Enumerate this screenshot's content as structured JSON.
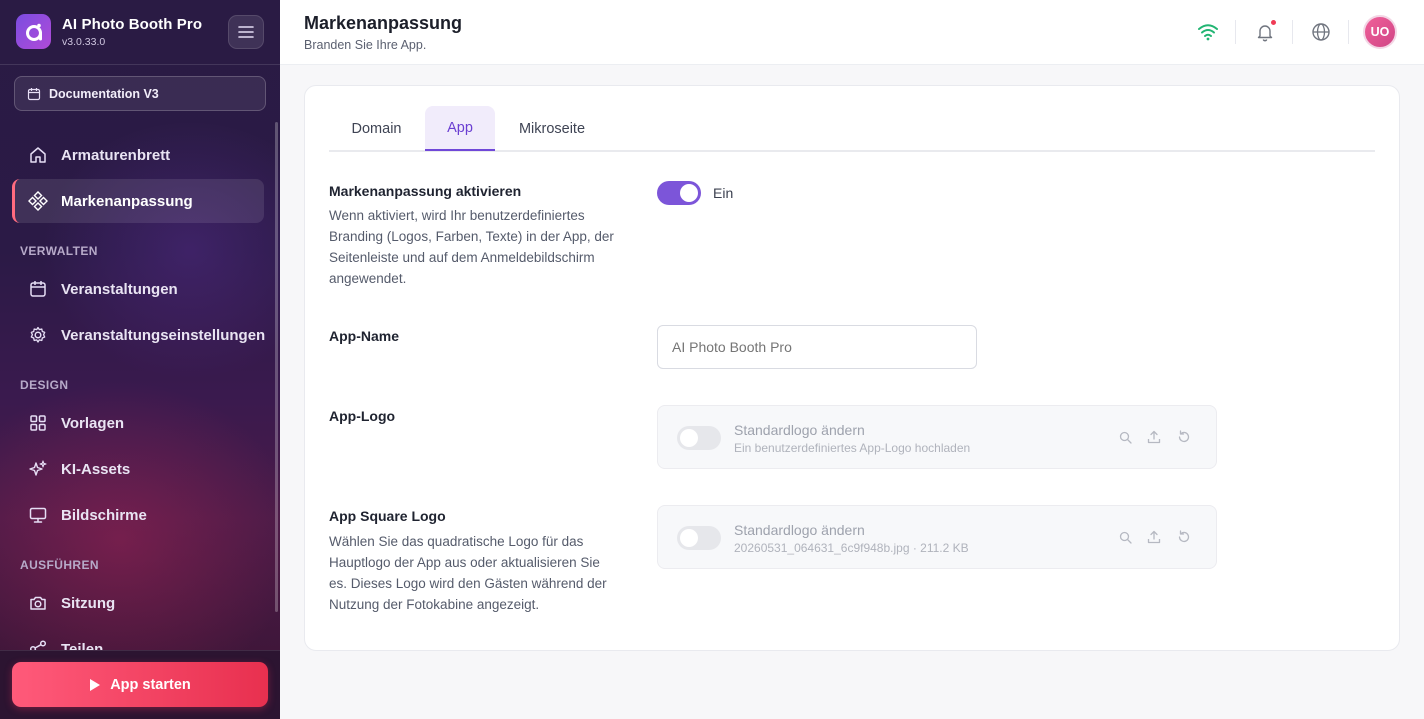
{
  "app": {
    "title": "AI Photo Booth Pro",
    "version": "v3.0.33.0"
  },
  "sidebar": {
    "doc_button": "Documentation V3",
    "items_top": [
      {
        "label": "Armaturenbrett",
        "icon": "home-icon"
      },
      {
        "label": "Markenanpassung",
        "icon": "diamond-grid-icon",
        "active": true
      }
    ],
    "section_manage": "VERWALTEN",
    "items_manage": [
      {
        "label": "Veranstaltungen",
        "icon": "calendar-icon"
      },
      {
        "label": "Veranstaltungseinstellungen",
        "icon": "gear-icon"
      }
    ],
    "section_design": "DESIGN",
    "items_design": [
      {
        "label": "Vorlagen",
        "icon": "grid-icon"
      },
      {
        "label": "KI-Assets",
        "icon": "sparkles-icon"
      },
      {
        "label": "Bildschirme",
        "icon": "monitor-icon"
      }
    ],
    "section_run": "AUSFÜHREN",
    "items_run": [
      {
        "label": "Sitzung",
        "icon": "camera-icon"
      },
      {
        "label": "Teilen",
        "icon": "share-icon"
      }
    ],
    "start_button": "App starten"
  },
  "header": {
    "title": "Markenanpassung",
    "subtitle": "Branden Sie Ihre App.",
    "avatar_initials": "UO",
    "colors": {
      "wifi": "#22b573",
      "notification_dot": "#ef3b55",
      "accent": "#7c55d9"
    }
  },
  "tabs": [
    {
      "label": "Domain",
      "active": false
    },
    {
      "label": "App",
      "active": true
    },
    {
      "label": "Mikroseite",
      "active": false
    }
  ],
  "form": {
    "branding": {
      "label": "Markenanpassung aktivieren",
      "description": "Wenn aktiviert, wird Ihr benutzerdefiniertes Branding (Logos, Farben, Texte) in der App, der Seitenleiste und auf dem Anmeldebildschirm angewendet.",
      "toggle_state": "Ein",
      "enabled": true
    },
    "app_name": {
      "label": "App-Name",
      "placeholder": "AI Photo Booth Pro"
    },
    "app_logo": {
      "label": "App-Logo",
      "title": "Standardlogo ändern",
      "subtitle": "Ein benutzerdefiniertes App-Logo hochladen"
    },
    "square_logo": {
      "label": "App Square Logo",
      "description": "Wählen Sie das quadratische Logo für das Hauptlogo der App aus oder aktualisieren Sie es. Dieses Logo wird den Gästen während der Nutzung der Fotokabine angezeigt.",
      "title": "Standardlogo ändern",
      "file_info": "20260531_064631_6c9f948b.jpg · 211.2 KB"
    }
  }
}
